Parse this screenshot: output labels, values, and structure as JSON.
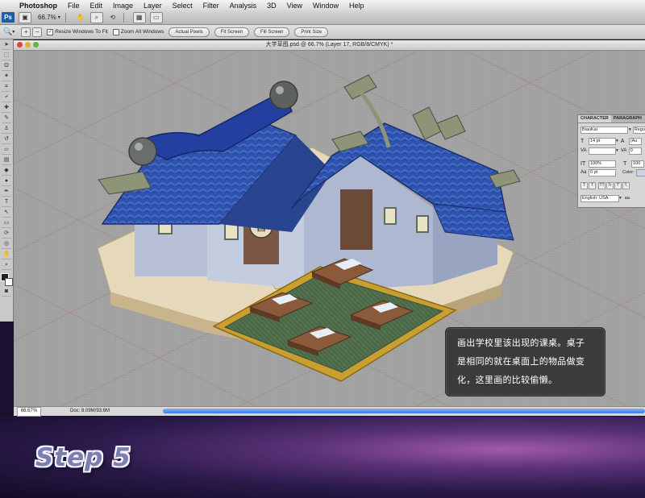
{
  "menubar": {
    "apple_glyph": "",
    "items": [
      "Photoshop",
      "File",
      "Edit",
      "Image",
      "Layer",
      "Select",
      "Filter",
      "Analysis",
      "3D",
      "View",
      "Window",
      "Help"
    ]
  },
  "appbar": {
    "logo": "Ps",
    "zoom": "66.7%"
  },
  "options": {
    "resize_windows": "Resize Windows To Fit",
    "zoom_all": "Zoom All Windows",
    "buttons": [
      "Actual Pixels",
      "Fit Screen",
      "Fill Screen",
      "Print Size"
    ]
  },
  "document": {
    "title": "大学草图.psd @ 66.7% (Layer 17, RGB/8/CMYK) *",
    "status_zoom": "66.67%",
    "doc_info": "Doc: 8.09M/93.6M"
  },
  "character_panel": {
    "tabs": [
      "CHARACTER",
      "PARAGRAPH"
    ],
    "font": "BiauKai",
    "style": "Regu",
    "size": "14 pt",
    "leading": "(Au",
    "tracking": "0",
    "vscale": "100%",
    "hscale": "100",
    "baseline": "0 pt",
    "color_label": "Color:",
    "style_buttons": [
      "T",
      "T",
      "TT",
      "Tr",
      "T'",
      "T,"
    ],
    "language": "English: USA",
    "aa": "aa"
  },
  "callout": {
    "lines": [
      "画出学校里该出现的课桌。桌子",
      "是相同的就在桌面上的物品做变",
      "化，这里画的比较偷懒。"
    ]
  },
  "sign_char": "書",
  "step_label": "Step 5",
  "colors": {
    "roof_blue": "#2e4fa8",
    "wall_light": "#b7c0d6",
    "platform": "#e6d8bb",
    "mat_green": "#4e6a4a",
    "desk_brown": "#7a4a2e"
  }
}
